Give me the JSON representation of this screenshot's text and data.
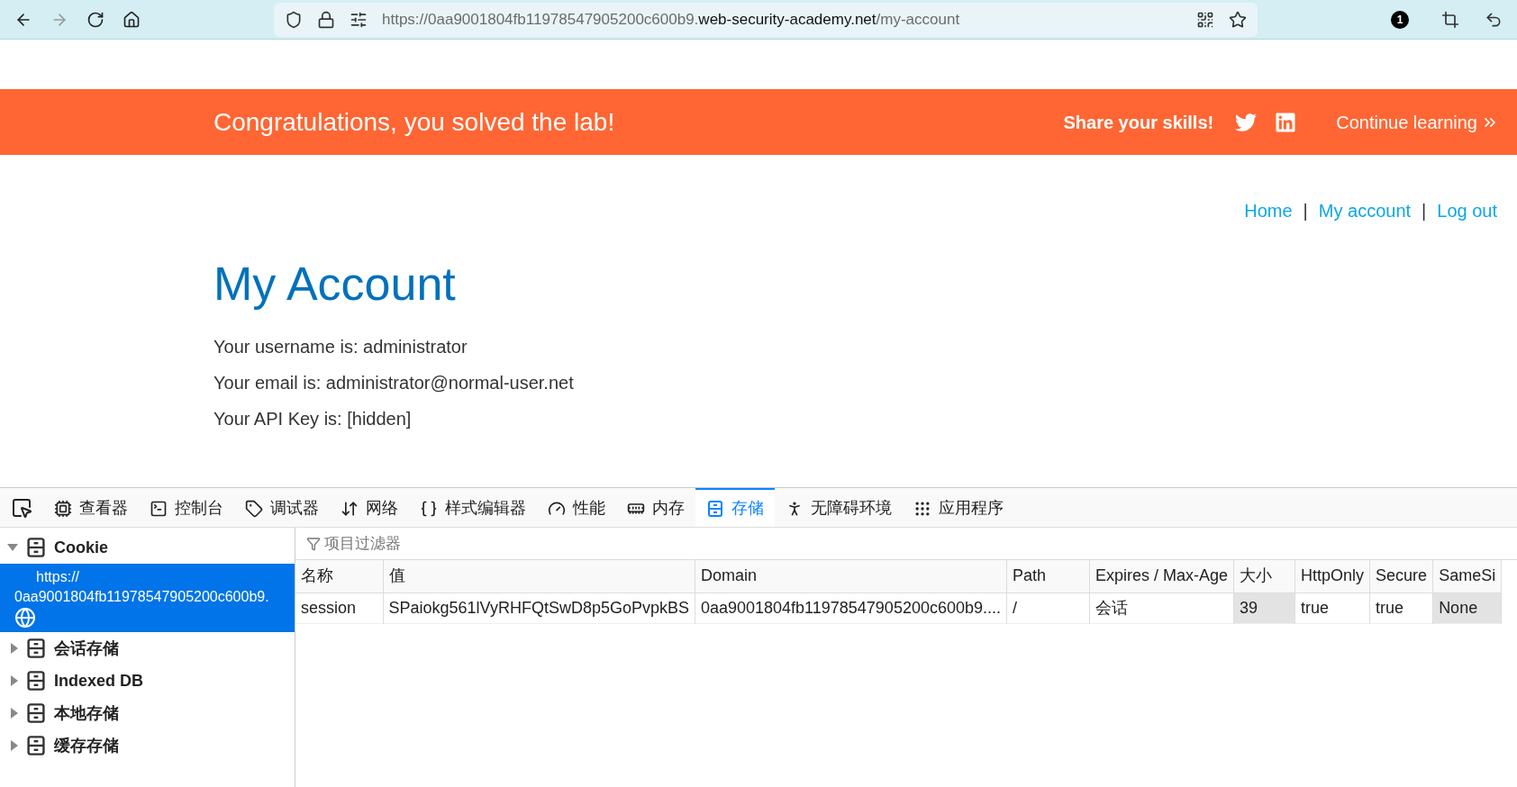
{
  "browser": {
    "url": {
      "prefix": "https://0aa9001804fb11978547905200c600b9.",
      "host": "web-security-academy.net",
      "path": "/my-account"
    },
    "badge": "1"
  },
  "banner": {
    "message": "Congratulations, you solved the lab!",
    "share": "Share your skills!",
    "continue": "Continue learning"
  },
  "nav": [
    {
      "kind": "link",
      "text": "Home"
    },
    {
      "kind": "separator",
      "text": "|"
    },
    {
      "kind": "link",
      "text": "My account"
    },
    {
      "kind": "separator",
      "text": "|"
    },
    {
      "kind": "link",
      "text": "Log out"
    }
  ],
  "heading": "My Account",
  "details": [
    "Your username is: administrator",
    "Your email is: administrator@normal-user.net",
    "Your API Key is: [hidden]"
  ],
  "devtools": {
    "tabs": [
      {
        "kind": "inspector",
        "label": "查看器",
        "selected": false
      },
      {
        "kind": "console",
        "label": "控制台",
        "selected": false
      },
      {
        "kind": "debugger",
        "label": "调试器",
        "selected": false
      },
      {
        "kind": "network",
        "label": "网络",
        "selected": false
      },
      {
        "kind": "style",
        "label": "样式编辑器",
        "selected": false
      },
      {
        "kind": "performance",
        "label": "性能",
        "selected": false
      },
      {
        "kind": "memory",
        "label": "内存",
        "selected": false
      },
      {
        "kind": "storage",
        "label": "存储",
        "selected": true
      },
      {
        "kind": "accessibility",
        "label": "无障碍环境",
        "selected": false
      },
      {
        "kind": "apps",
        "label": "应用程序",
        "selected": false
      }
    ],
    "sidebar": [
      {
        "label": "Cookie",
        "expanded": true,
        "children": [
          {
            "lines": [
              "https://",
              "0aa9001804fb11978547905200c600b9."
            ],
            "selected": true
          }
        ]
      },
      {
        "label": "会话存储",
        "expanded": false
      },
      {
        "label": "Indexed DB",
        "expanded": false
      },
      {
        "label": "本地存储",
        "expanded": false
      },
      {
        "label": "缓存存储",
        "expanded": false
      }
    ],
    "filter": {
      "placeholder": "项目过滤器"
    },
    "table": {
      "columns": [
        "名称",
        "值",
        "Domain",
        "Path",
        "Expires / Max-Age",
        "大小",
        "HttpOnly",
        "Secure",
        "SameSi"
      ],
      "rows": [
        {
          "cells": [
            {
              "text": "session",
              "shaded": false
            },
            {
              "text": "SPaiokg561lVyRHFQtSwD8p5GoPvpkBS",
              "shaded": false
            },
            {
              "text": "0aa9001804fb11978547905200c600b9....",
              "shaded": false
            },
            {
              "text": "/",
              "shaded": false
            },
            {
              "text": "会话",
              "shaded": false
            },
            {
              "text": "39",
              "shaded": true
            },
            {
              "text": "true",
              "shaded": false
            },
            {
              "text": "true",
              "shaded": false
            },
            {
              "text": "None",
              "shaded": true
            }
          ]
        }
      ]
    }
  }
}
